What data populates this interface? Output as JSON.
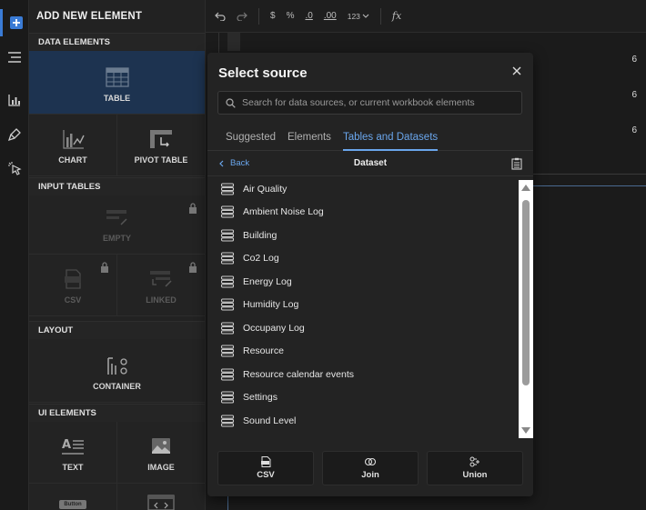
{
  "panel": {
    "title": "ADD NEW ELEMENT",
    "sections": {
      "data": "DATA ELEMENTS",
      "input": "INPUT TABLES",
      "layout": "LAYOUT",
      "ui": "UI ELEMENTS"
    },
    "tiles": {
      "table": "TABLE",
      "chart": "CHART",
      "pivot": "PIVOT TABLE",
      "empty": "EMPTY",
      "csv": "CSV",
      "linked": "LINKED",
      "container": "CONTAINER",
      "text": "TEXT",
      "image": "IMAGE",
      "button_preview": "Button"
    }
  },
  "toolbar": {
    "dollar": "$",
    "percent": "%",
    "dec_less": ".0",
    "dec_more": ".00",
    "number_format": "123",
    "fx": "fx"
  },
  "grid": {
    "values": [
      "6",
      "6",
      "6"
    ]
  },
  "modal": {
    "title": "Select source",
    "search_placeholder": "Search for data sources, or current workbook elements",
    "tabs": [
      "Suggested",
      "Elements",
      "Tables and Datasets"
    ],
    "back_label": "Back",
    "subtitle": "Dataset",
    "items": [
      "Air Quality",
      "Ambient Noise Log",
      "Building",
      "Co2 Log",
      "Energy Log",
      "Humidity Log",
      "Occupany Log",
      "Resource",
      "Resource calendar events",
      "Settings",
      "Sound Level"
    ],
    "actions": {
      "csv": "CSV",
      "join": "Join",
      "union": "Union"
    }
  },
  "colors": {
    "accent": "#6aa6ec",
    "selected_tile": "#1d3350",
    "rail_active": "#3a7bd5"
  }
}
